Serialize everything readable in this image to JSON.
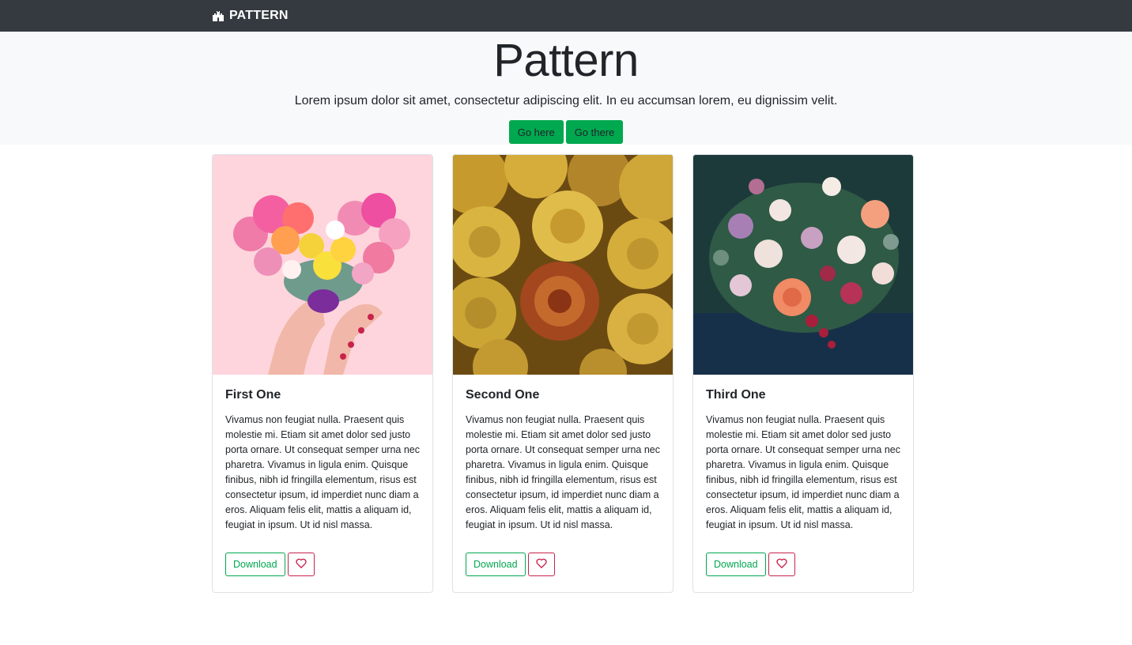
{
  "navbar": {
    "brand": "PATTERN",
    "brand_icon": "castle-icon"
  },
  "hero": {
    "title": "Pattern",
    "lead": "Lorem ipsum dolor sit amet, consectetur adipiscing elit. In eu accumsan lorem, eu dignissim velit.",
    "buttons": [
      "Go here",
      "Go there"
    ]
  },
  "cards": [
    {
      "title": "First One",
      "text": "Vivamus non feugiat nulla. Praesent quis molestie mi. Etiam sit amet dolor sed justo porta ornare. Ut consequat semper urna nec pharetra. Vivamus in ligula enim. Quisque finibus, nibh id fringilla elementum, risus est consectetur ipsum, id imperdiet nunc diam a eros. Aliquam felis elit, mattis a aliquam id, feugiat in ipsum. Ut id nisl massa.",
      "download_label": "Download",
      "image": "heart-of-flowers-photo"
    },
    {
      "title": "Second One",
      "text": "Vivamus non feugiat nulla. Praesent quis molestie mi. Etiam sit amet dolor sed justo porta ornare. Ut consequat semper urna nec pharetra. Vivamus in ligula enim. Quisque finibus, nibh id fringilla elementum, risus est consectetur ipsum, id imperdiet nunc diam a eros. Aliquam felis elit, mattis a aliquam id, feugiat in ipsum. Ut id nisl massa.",
      "download_label": "Download",
      "image": "yellow-roses-photo"
    },
    {
      "title": "Third One",
      "text": "Vivamus non feugiat nulla. Praesent quis molestie mi. Etiam sit amet dolor sed justo porta ornare. Ut consequat semper urna nec pharetra. Vivamus in ligula enim. Quisque finibus, nibh id fringilla elementum, risus est consectetur ipsum, id imperdiet nunc diam a eros. Aliquam felis elit, mattis a aliquam id, feugiat in ipsum. Ut id nisl massa.",
      "download_label": "Download",
      "image": "bouquet-photo"
    }
  ],
  "colors": {
    "navbar": "#343a40",
    "hero_bg": "#f8f9fa",
    "accent_green": "#00a84f",
    "heart_red": "#c8234a"
  }
}
